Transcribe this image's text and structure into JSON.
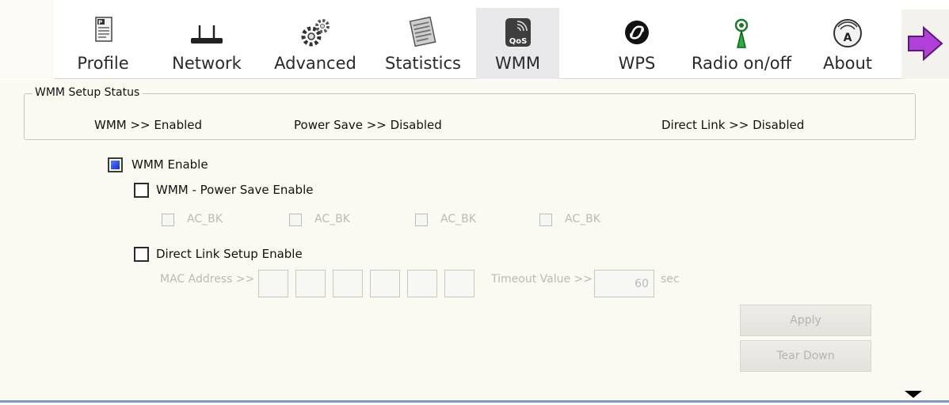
{
  "toolbar": {
    "tabs": [
      {
        "label": "Profile",
        "icon": "profile-icon"
      },
      {
        "label": "Network",
        "icon": "network-icon"
      },
      {
        "label": "Advanced",
        "icon": "gears-icon"
      },
      {
        "label": "Statistics",
        "icon": "statistics-icon"
      },
      {
        "label": "WMM",
        "icon": "qos-icon",
        "badge": "QoS"
      },
      {
        "label": "WPS",
        "icon": "wps-icon"
      },
      {
        "label": "Radio on/off",
        "icon": "radio-antenna-icon"
      },
      {
        "label": "About",
        "icon": "about-icon",
        "badge": "A"
      }
    ],
    "active_tab": "WMM",
    "next_icon": "arrow-right-icon"
  },
  "status": {
    "legend": "WMM Setup Status",
    "wmm": "WMM >> Enabled",
    "power_save": "Power Save >> Disabled",
    "direct_link": "Direct Link >> Disabled"
  },
  "wmm_enable": {
    "label": "WMM Enable",
    "checked": true
  },
  "power_save_enable": {
    "label": "WMM - Power Save Enable",
    "checked": false
  },
  "ac_options": [
    "AC_BK",
    "AC_BK",
    "AC_BK",
    "AC_BK"
  ],
  "direct_link_enable": {
    "label": "Direct Link Setup Enable",
    "checked": false
  },
  "mac_address_label": "MAC Address >>",
  "timeout": {
    "label": "Timeout Value >>",
    "value": "60",
    "unit": "sec"
  },
  "buttons": {
    "apply": "Apply",
    "tear_down": "Tear Down"
  },
  "colors": {
    "active_tab": "#e9e9ec",
    "panel": "#fbfaf2",
    "check_fill": "#1436dc",
    "next_arrow": "#b040d8"
  }
}
